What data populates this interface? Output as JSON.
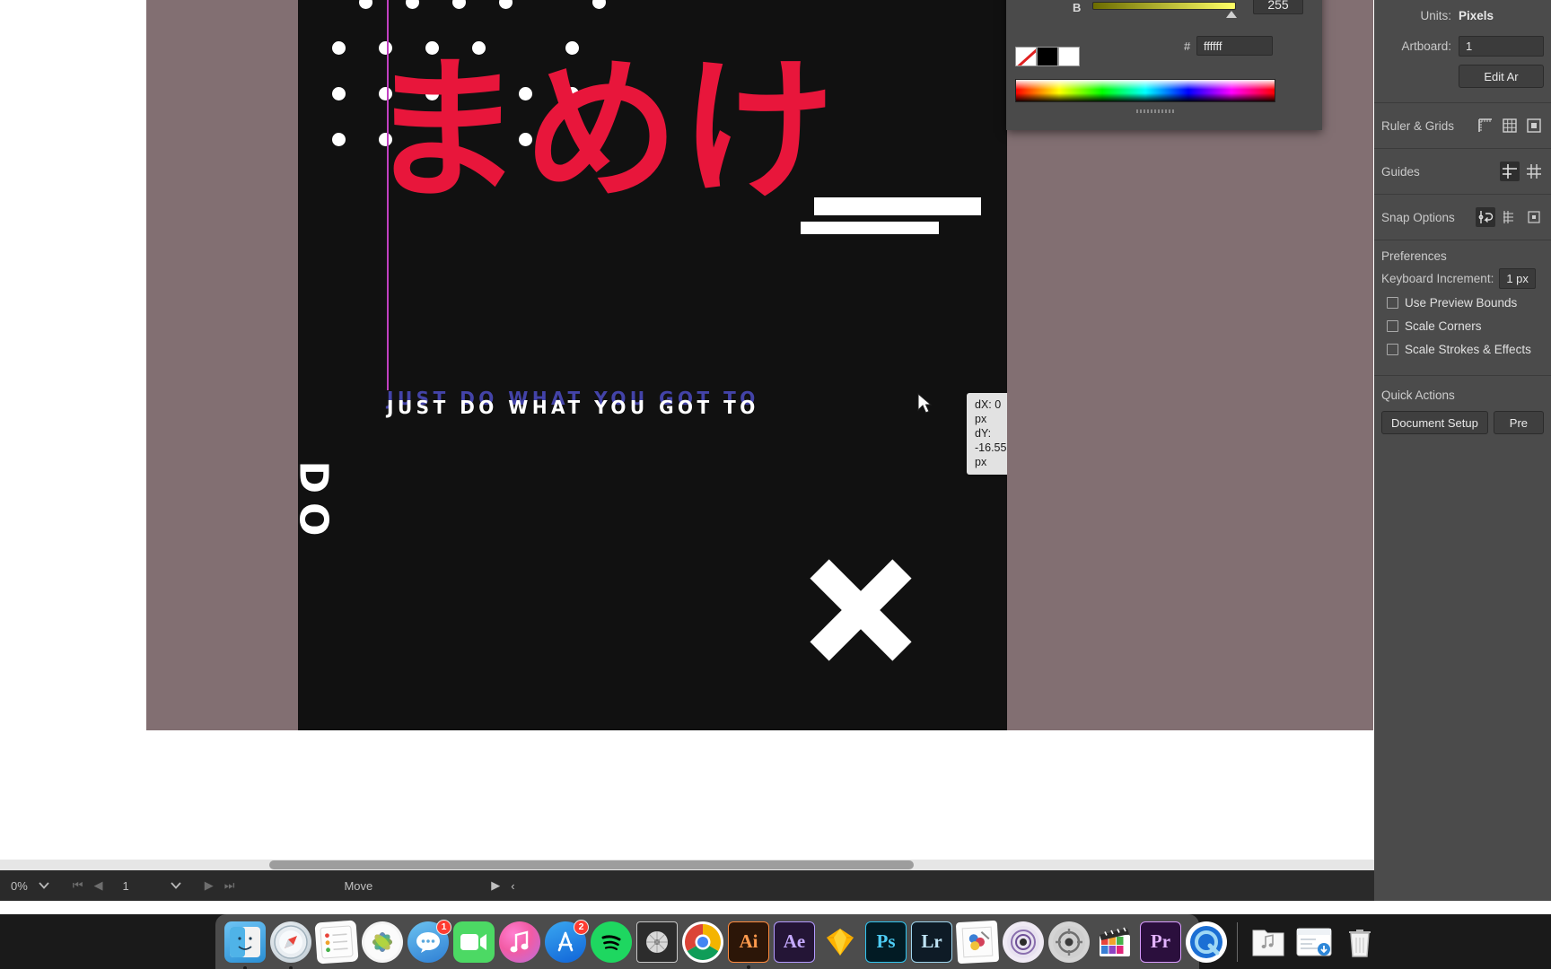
{
  "app": {
    "name": "Adobe Illustrator",
    "tool_status": "Move"
  },
  "canvas": {
    "headline_jp": "まめけ",
    "sub_headline": "JUST DO WHAT YOU GOT TO",
    "rotated_mark": "DO",
    "dot_grid": {
      "rows": 4,
      "cols": 6,
      "color": "#ffffff"
    },
    "artboard_bg": "#111111",
    "accent_red": "#e8163b",
    "guide_color": "#c040c0",
    "measure_tooltip": {
      "dx": "dX: 0 px",
      "dy": "dY: -16.55 px"
    }
  },
  "color_panel": {
    "brightness_label": "B",
    "brightness_value": "255",
    "hash_symbol": "#",
    "hex_value": "ffffff",
    "swatches": [
      "none-swatch",
      "black-swatch",
      "white-swatch"
    ]
  },
  "properties_panel": {
    "units_label": "Units:",
    "units_value": "Pixels",
    "artboard_label": "Artboard:",
    "artboard_value": "1",
    "edit_artboards_label": "Edit Ar",
    "rows": [
      {
        "label": "Ruler & Grids",
        "icons": [
          "ruler-icon",
          "grid-icon",
          "pixel-grid-icon"
        ]
      },
      {
        "label": "Guides",
        "icons": [
          "show-guides-icon",
          "lock-guides-icon"
        ]
      },
      {
        "label": "Snap Options",
        "icons": [
          "smart-guides-icon",
          "snap-to-grid-icon",
          "snap-to-pixel-icon"
        ]
      }
    ],
    "preferences_title": "Preferences",
    "keyboard_increment_label": "Keyboard Increment:",
    "keyboard_increment_value": "1 px",
    "checkboxes": [
      {
        "label": "Use Preview Bounds",
        "checked": false
      },
      {
        "label": "Scale Corners",
        "checked": false
      },
      {
        "label": "Scale Strokes & Effects",
        "checked": false
      }
    ],
    "quick_actions_title": "Quick Actions",
    "quick_actions": [
      "Document Setup",
      "Pre"
    ]
  },
  "status_bar": {
    "zoom_value": "0%",
    "page_number": "1",
    "tool_name": "Move",
    "nav_first": "⏮",
    "nav_prev": "◀",
    "nav_next": "▶",
    "nav_last": "⏭",
    "play": "▶",
    "collapse": "‹"
  },
  "dock": {
    "items": [
      {
        "name": "finder",
        "label": "",
        "badge": null,
        "running": true
      },
      {
        "name": "safari",
        "label": "",
        "badge": null,
        "running": true
      },
      {
        "name": "reminders",
        "label": "",
        "badge": null,
        "running": false
      },
      {
        "name": "photos",
        "label": "",
        "badge": null,
        "running": false
      },
      {
        "name": "messages",
        "label": "",
        "badge": "1",
        "running": false
      },
      {
        "name": "facetime",
        "label": "",
        "badge": null,
        "running": false
      },
      {
        "name": "itunes",
        "label": "",
        "badge": null,
        "running": false
      },
      {
        "name": "app-store",
        "label": "",
        "badge": "2",
        "running": false
      },
      {
        "name": "spotify",
        "label": "",
        "badge": null,
        "running": false
      },
      {
        "name": "activity-monitor",
        "label": "",
        "badge": null,
        "running": false
      },
      {
        "name": "google-chrome",
        "label": "",
        "badge": null,
        "running": false
      },
      {
        "name": "adobe-illustrator",
        "label": "Ai",
        "badge": null,
        "running": true
      },
      {
        "name": "adobe-after-effects",
        "label": "Ae",
        "badge": null,
        "running": false
      },
      {
        "name": "sketch",
        "label": "",
        "badge": null,
        "running": false
      },
      {
        "name": "adobe-photoshop",
        "label": "Ps",
        "badge": null,
        "running": false
      },
      {
        "name": "adobe-lightroom",
        "label": "Lr",
        "badge": null,
        "running": false
      },
      {
        "name": "preview",
        "label": "",
        "badge": null,
        "running": false
      },
      {
        "name": "logic-pro",
        "label": "",
        "badge": null,
        "running": false
      },
      {
        "name": "compressor",
        "label": "",
        "badge": null,
        "running": false
      },
      {
        "name": "final-cut-pro",
        "label": "",
        "badge": null,
        "running": false
      },
      {
        "name": "adobe-premiere-pro",
        "label": "Pr",
        "badge": null,
        "running": false
      },
      {
        "name": "quicktime-player",
        "label": "",
        "badge": null,
        "running": true
      }
    ],
    "stack_items": [
      {
        "name": "music-folder"
      },
      {
        "name": "downloads-folder"
      },
      {
        "name": "trash"
      }
    ]
  }
}
